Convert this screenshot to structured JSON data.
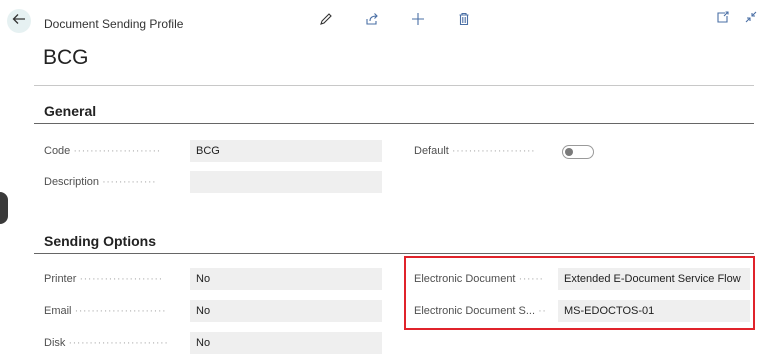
{
  "header": {
    "eyebrow": "Document Sending Profile",
    "title": "BCG"
  },
  "sections": {
    "general": "General",
    "sending_options": "Sending Options"
  },
  "general_fields": {
    "code_label": "Code",
    "code_value": "BCG",
    "description_label": "Description",
    "description_value": "",
    "default_label": "Default",
    "default_on": false
  },
  "sending_fields": {
    "printer_label": "Printer",
    "printer_value": "No",
    "email_label": "Email",
    "email_value": "No",
    "disk_label": "Disk",
    "disk_value": "No",
    "edoc_label": "Electronic Document",
    "edoc_value": "Extended E-Document Service Flow",
    "edoc_service_label": "Electronic Document S...",
    "edoc_service_value": "MS-EDOCTOS-01"
  },
  "colors": {
    "highlight": "#e0232b",
    "field_bg": "#efefef",
    "back_bg": "#e6f1f2"
  }
}
